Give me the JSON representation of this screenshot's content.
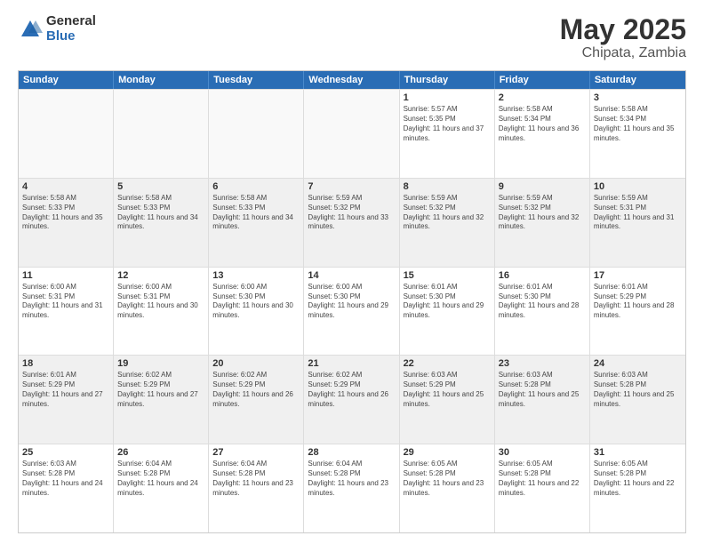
{
  "logo": {
    "general": "General",
    "blue": "Blue"
  },
  "title": "May 2025",
  "location": "Chipata, Zambia",
  "header_days": [
    "Sunday",
    "Monday",
    "Tuesday",
    "Wednesday",
    "Thursday",
    "Friday",
    "Saturday"
  ],
  "rows": [
    [
      {
        "day": "",
        "empty": true
      },
      {
        "day": "",
        "empty": true
      },
      {
        "day": "",
        "empty": true
      },
      {
        "day": "",
        "empty": true
      },
      {
        "day": "1",
        "sunrise": "5:57 AM",
        "sunset": "5:35 PM",
        "daylight": "11 hours and 37 minutes."
      },
      {
        "day": "2",
        "sunrise": "5:58 AM",
        "sunset": "5:34 PM",
        "daylight": "11 hours and 36 minutes."
      },
      {
        "day": "3",
        "sunrise": "5:58 AM",
        "sunset": "5:34 PM",
        "daylight": "11 hours and 35 minutes."
      }
    ],
    [
      {
        "day": "4",
        "sunrise": "5:58 AM",
        "sunset": "5:33 PM",
        "daylight": "11 hours and 35 minutes."
      },
      {
        "day": "5",
        "sunrise": "5:58 AM",
        "sunset": "5:33 PM",
        "daylight": "11 hours and 34 minutes."
      },
      {
        "day": "6",
        "sunrise": "5:58 AM",
        "sunset": "5:33 PM",
        "daylight": "11 hours and 34 minutes."
      },
      {
        "day": "7",
        "sunrise": "5:59 AM",
        "sunset": "5:32 PM",
        "daylight": "11 hours and 33 minutes."
      },
      {
        "day": "8",
        "sunrise": "5:59 AM",
        "sunset": "5:32 PM",
        "daylight": "11 hours and 32 minutes."
      },
      {
        "day": "9",
        "sunrise": "5:59 AM",
        "sunset": "5:32 PM",
        "daylight": "11 hours and 32 minutes."
      },
      {
        "day": "10",
        "sunrise": "5:59 AM",
        "sunset": "5:31 PM",
        "daylight": "11 hours and 31 minutes."
      }
    ],
    [
      {
        "day": "11",
        "sunrise": "6:00 AM",
        "sunset": "5:31 PM",
        "daylight": "11 hours and 31 minutes."
      },
      {
        "day": "12",
        "sunrise": "6:00 AM",
        "sunset": "5:31 PM",
        "daylight": "11 hours and 30 minutes."
      },
      {
        "day": "13",
        "sunrise": "6:00 AM",
        "sunset": "5:30 PM",
        "daylight": "11 hours and 30 minutes."
      },
      {
        "day": "14",
        "sunrise": "6:00 AM",
        "sunset": "5:30 PM",
        "daylight": "11 hours and 29 minutes."
      },
      {
        "day": "15",
        "sunrise": "6:01 AM",
        "sunset": "5:30 PM",
        "daylight": "11 hours and 29 minutes."
      },
      {
        "day": "16",
        "sunrise": "6:01 AM",
        "sunset": "5:30 PM",
        "daylight": "11 hours and 28 minutes."
      },
      {
        "day": "17",
        "sunrise": "6:01 AM",
        "sunset": "5:29 PM",
        "daylight": "11 hours and 28 minutes."
      }
    ],
    [
      {
        "day": "18",
        "sunrise": "6:01 AM",
        "sunset": "5:29 PM",
        "daylight": "11 hours and 27 minutes."
      },
      {
        "day": "19",
        "sunrise": "6:02 AM",
        "sunset": "5:29 PM",
        "daylight": "11 hours and 27 minutes."
      },
      {
        "day": "20",
        "sunrise": "6:02 AM",
        "sunset": "5:29 PM",
        "daylight": "11 hours and 26 minutes."
      },
      {
        "day": "21",
        "sunrise": "6:02 AM",
        "sunset": "5:29 PM",
        "daylight": "11 hours and 26 minutes."
      },
      {
        "day": "22",
        "sunrise": "6:03 AM",
        "sunset": "5:29 PM",
        "daylight": "11 hours and 25 minutes."
      },
      {
        "day": "23",
        "sunrise": "6:03 AM",
        "sunset": "5:28 PM",
        "daylight": "11 hours and 25 minutes."
      },
      {
        "day": "24",
        "sunrise": "6:03 AM",
        "sunset": "5:28 PM",
        "daylight": "11 hours and 25 minutes."
      }
    ],
    [
      {
        "day": "25",
        "sunrise": "6:03 AM",
        "sunset": "5:28 PM",
        "daylight": "11 hours and 24 minutes."
      },
      {
        "day": "26",
        "sunrise": "6:04 AM",
        "sunset": "5:28 PM",
        "daylight": "11 hours and 24 minutes."
      },
      {
        "day": "27",
        "sunrise": "6:04 AM",
        "sunset": "5:28 PM",
        "daylight": "11 hours and 23 minutes."
      },
      {
        "day": "28",
        "sunrise": "6:04 AM",
        "sunset": "5:28 PM",
        "daylight": "11 hours and 23 minutes."
      },
      {
        "day": "29",
        "sunrise": "6:05 AM",
        "sunset": "5:28 PM",
        "daylight": "11 hours and 23 minutes."
      },
      {
        "day": "30",
        "sunrise": "6:05 AM",
        "sunset": "5:28 PM",
        "daylight": "11 hours and 22 minutes."
      },
      {
        "day": "31",
        "sunrise": "6:05 AM",
        "sunset": "5:28 PM",
        "daylight": "11 hours and 22 minutes."
      }
    ]
  ]
}
